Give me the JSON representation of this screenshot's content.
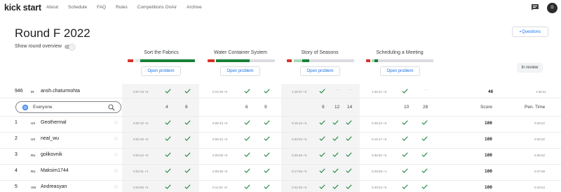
{
  "nav": {
    "logo": "kick start",
    "links": [
      "About",
      "Schedule",
      "FAQ",
      "Rules",
      "Competitions OnAir",
      "Archive"
    ]
  },
  "page": {
    "title": "Round F 2022",
    "questions_label": "Questions",
    "overview_label": "Show round overview",
    "in_review": "In review"
  },
  "colors": {
    "accent": "#1a73e8",
    "green": "#188038",
    "red": "#d93025"
  },
  "problems": [
    {
      "name": "Sort the Fabrics",
      "button": "Open problem",
      "bar": [
        [
          "#d93025",
          0.08
        ],
        [
          "#ffffff",
          0.03
        ],
        [
          "#e8e8e8",
          0.08
        ],
        [
          "#188038",
          0.81
        ]
      ]
    },
    {
      "name": "Water Container System",
      "button": "Open problem",
      "bar": [
        [
          "#d93025",
          0.1
        ],
        [
          "#ffffff",
          0.03
        ],
        [
          "#188038",
          0.5
        ],
        [
          "#dadce0",
          0.37
        ]
      ]
    },
    {
      "name": "Story of Seasons",
      "button": "Open problem",
      "bar": [
        [
          "#d93025",
          0.07
        ],
        [
          "#ffffff",
          0.03
        ],
        [
          "#a8dab5",
          0.13
        ],
        [
          "#188038",
          0.1
        ],
        [
          "#dadce0",
          0.67
        ]
      ]
    },
    {
      "name": "Scheduling a Meeting",
      "button": "Open problem",
      "bar": [
        [
          "#d93025",
          0.06
        ],
        [
          "#ffffff",
          0.02
        ],
        [
          "#a8dab5",
          0.05
        ],
        [
          "#188038",
          0.05
        ],
        [
          "#dadce0",
          0.82
        ]
      ]
    }
  ],
  "me": {
    "rank": "946",
    "country": "IN",
    "name": "ansh.chaturmohta",
    "times": [
      "0:07:18 +0",
      "0:24:29 +0",
      "1:18:07 +0",
      "1:36:41 +0"
    ],
    "score": "46",
    "pen": "1:36:41"
  },
  "search": {
    "placeholder": "Everyone"
  },
  "columns": {
    "p1": [
      "4",
      "8"
    ],
    "p2": [
      "6",
      "9"
    ],
    "p3": [
      "9",
      "12",
      "14"
    ],
    "p4": [
      "10",
      "28"
    ],
    "score": "Score",
    "pen": "Pen. Time"
  },
  "rows": [
    {
      "rank": "1",
      "country": "US",
      "name": "Geothermal",
      "times": [
        "0:02:10 +0",
        "0:05:43 +0",
        "0:16:16 +0",
        "0:28:22 +0"
      ],
      "score": "100",
      "pen": "0:28:22"
    },
    {
      "rank": "2",
      "country": "US",
      "name": "neal_wu",
      "times": [
        "0:02:46 +0",
        "0:06:34 +0",
        "0:20:02 +0",
        "0:19:17 +0"
      ],
      "score": "100",
      "pen": "0:30:02"
    },
    {
      "rank": "3",
      "country": "RU",
      "name": "golikovnik",
      "times": [
        "0:02:24 +0",
        "0:09:08 +0",
        "0:25:48 +0",
        "0:36:52 +0"
      ],
      "score": "100",
      "pen": "0:36:52"
    },
    {
      "rank": "4",
      "country": "RU",
      "name": "Maksim1744",
      "times": [
        "0:03:31 +1",
        "0:09:38 +0",
        "0:17:05 +0",
        "0:29:59 +1"
      ],
      "score": "100",
      "pen": "0:37:59"
    },
    {
      "rank": "5",
      "country": "AM",
      "name": "Andreasyan",
      "times": [
        "0:03:56 +0",
        "0:11:54 +0",
        "0:22:46 +0",
        "0:40:04 +0"
      ],
      "score": "100",
      "pen": "0:40:04"
    }
  ]
}
